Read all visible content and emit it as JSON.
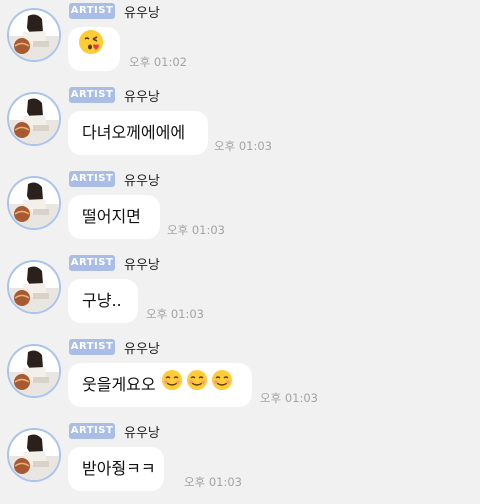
{
  "messages": [
    {
      "badge": "ARTIST",
      "sender": "유우낭",
      "text": "",
      "emoji": "kissing-face-emoji",
      "time": "오후 01:02"
    },
    {
      "badge": "ARTIST",
      "sender": "유우낭",
      "text": "다녀오께에에에",
      "time": "오후 01:03"
    },
    {
      "badge": "ARTIST",
      "sender": "유우낭",
      "text": "떨어지면",
      "time": "오후 01:03"
    },
    {
      "badge": "ARTIST",
      "sender": "유우낭",
      "text": "구냥..",
      "time": "오후 01:03"
    },
    {
      "badge": "ARTIST",
      "sender": "유우낭",
      "text": "웃을게요오",
      "emoji": "smiling-face-emoji",
      "time": "오후 01:03"
    },
    {
      "badge": "ARTIST",
      "sender": "유우낭",
      "text": "받아줭ㅋㅋ",
      "time": "오후 01:03"
    }
  ],
  "colors": {
    "background": "#f1f1f1",
    "badge": "#a9bde6",
    "bubble": "#ffffff",
    "avatar_ring": "#a9c3ec",
    "timestamp": "#a3a3a3"
  }
}
